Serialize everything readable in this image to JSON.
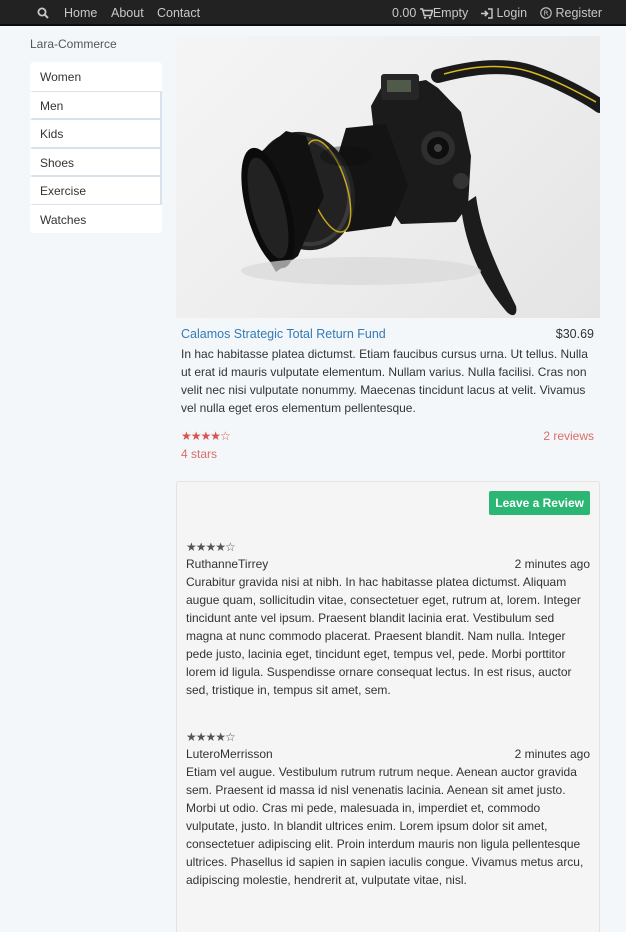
{
  "navbar": {
    "home": "Home",
    "about": "About",
    "contact": "Contact",
    "cart_total": "0.00",
    "cart_status": "Empty",
    "login": "Login",
    "register": "Register"
  },
  "brand": "Lara-Commerce",
  "sidebar": {
    "items": [
      {
        "label": "Women"
      },
      {
        "label": "Men"
      },
      {
        "label": "Kids"
      },
      {
        "label": "Shoes"
      },
      {
        "label": "Exercise"
      },
      {
        "label": "Watches"
      }
    ]
  },
  "product": {
    "title": "Calamos Strategic Total Return Fund",
    "price": "$30.69",
    "description": "In hac habitasse platea dictumst. Etiam faucibus cursus urna. Ut tellus. Nulla ut erat id mauris vulputate elementum. Nullam varius. Nulla facilisi. Cras non velit nec nisi vulputate nonummy. Maecenas tincidunt lacus at velit. Vivamus vel nulla eget eros elementum pellentesque.",
    "rating": 4,
    "rating_max": 5,
    "rating_text": "4 stars",
    "reviews_count": "2 reviews"
  },
  "reviews_panel": {
    "button_label": "Leave a Review",
    "reviews": [
      {
        "rating": 4,
        "author": "RuthanneTirrey",
        "time": "2 minutes ago",
        "body": "Curabitur gravida nisi at nibh. In hac habitasse platea dictumst. Aliquam augue quam, sollicitudin vitae, consectetuer eget, rutrum at, lorem. Integer tincidunt ante vel ipsum. Praesent blandit lacinia erat. Vestibulum sed magna at nunc commodo placerat. Praesent blandit. Nam nulla. Integer pede justo, lacinia eget, tincidunt eget, tempus vel, pede. Morbi porttitor lorem id ligula. Suspendisse ornare consequat lectus. In est risus, auctor sed, tristique in, tempus sit amet, sem."
      },
      {
        "rating": 4,
        "author": "LuteroMerrisson",
        "time": "2 minutes ago",
        "body": "Etiam vel augue. Vestibulum rutrum rutrum neque. Aenean auctor gravida sem. Praesent id massa id nisl venenatis lacinia. Aenean sit amet justo. Morbi ut odio. Cras mi pede, malesuada in, imperdiet et, commodo vulputate, justo. In blandit ultrices enim. Lorem ipsum dolor sit amet, consectetuer adipiscing elit. Proin interdum mauris non ligula pellentesque ultrices. Phasellus id sapien in sapien iaculis congue. Vivamus metus arcu, adipiscing molestie, hendrerit at, vulputate vitae, nisl."
      }
    ]
  },
  "colors": {
    "navbar": "#222222",
    "link": "#337ab7",
    "rating_red": "#d9534f",
    "review_button": "#2bb673"
  },
  "icons": {
    "search": "search-icon",
    "cart": "cart-icon",
    "login": "login-icon",
    "register": "registered-icon"
  }
}
